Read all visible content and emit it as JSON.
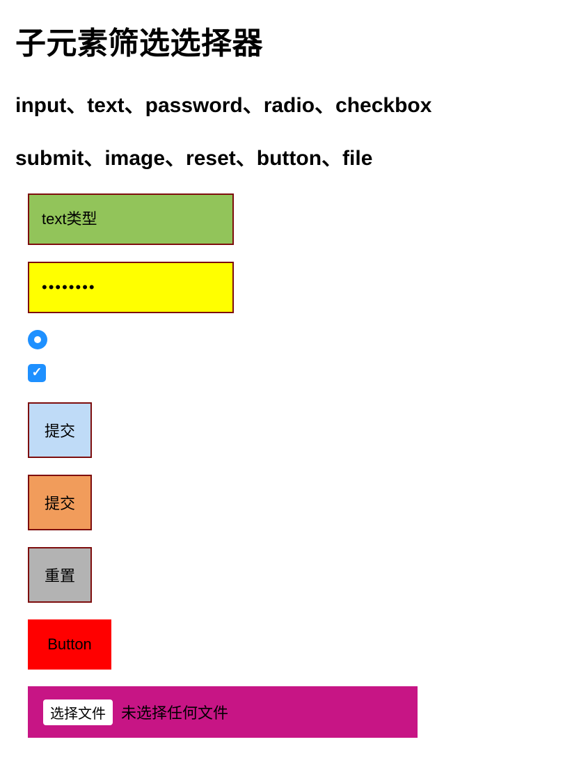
{
  "title": "子元素筛选选择器",
  "line1": "input、text、password、radio、checkbox",
  "line2": "submit、image、reset、button、file",
  "textField": {
    "placeholder": "text类型"
  },
  "passwordField": {
    "value": "00000000"
  },
  "submitLabel": "提交",
  "imageSubmitLabel": "提交",
  "resetLabel": "重置",
  "buttonLabel": "Button",
  "file": {
    "pick": "选择文件",
    "status": "未选择任何文件"
  }
}
